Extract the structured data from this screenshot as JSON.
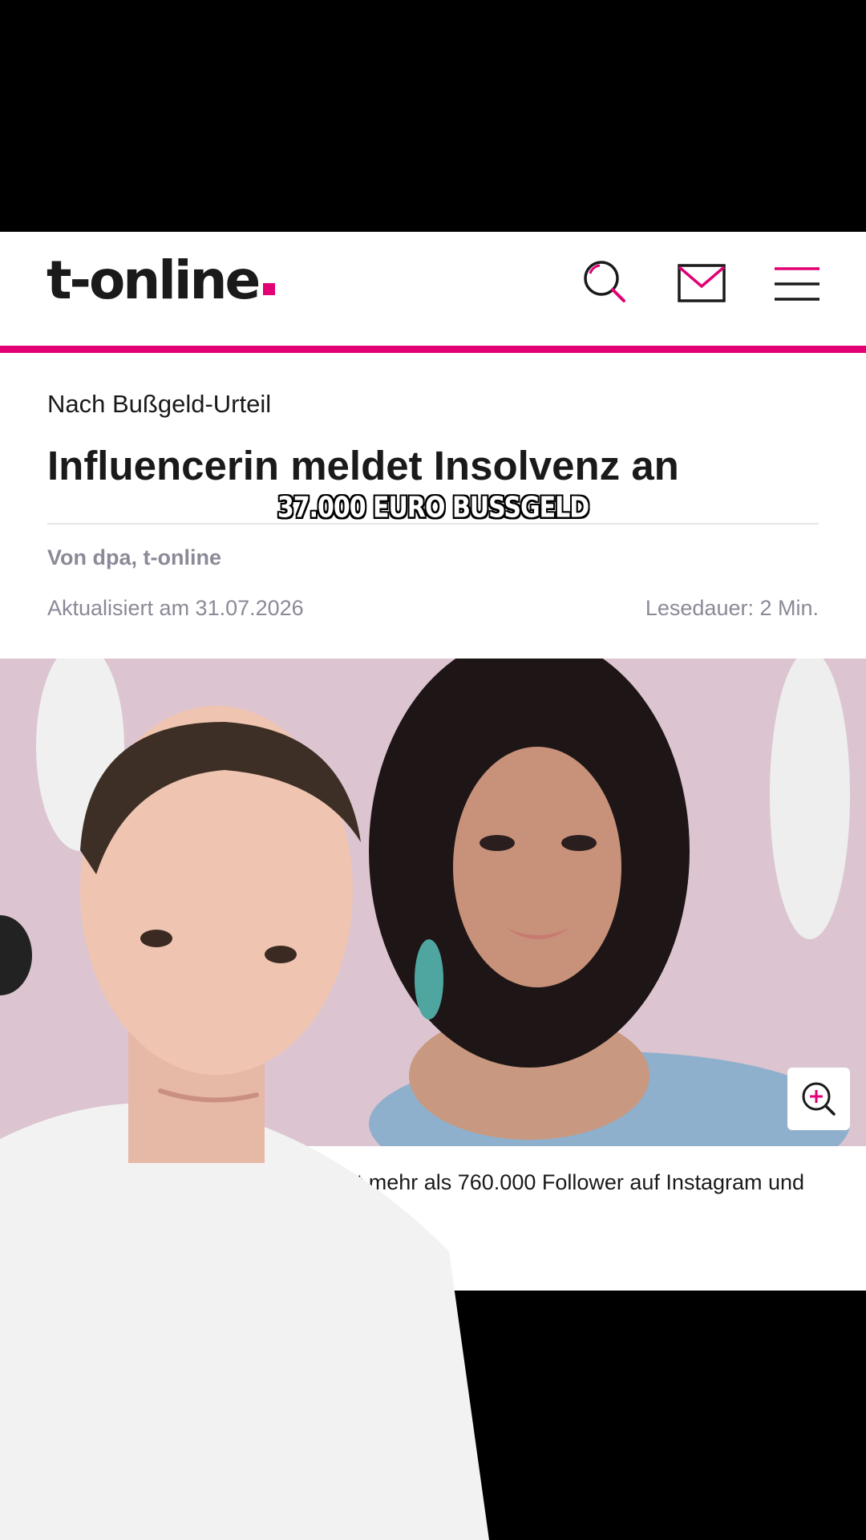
{
  "header": {
    "logo_text": "t-online",
    "accent_color": "#e20074",
    "icons": [
      "search-icon",
      "mail-icon",
      "menu-icon"
    ]
  },
  "article": {
    "kicker": "Nach Bußgeld-Urteil",
    "headline": "Influencerin meldet Insolvenz an",
    "author": "Von dpa, t-online",
    "updated": "Aktualisiert am 31.07.2026",
    "reading_time": "Lesedauer: 2 Min.",
    "image_caption": "Die Influencerin aus Stuttgart hat mehr als 760.000 Follower auf Instagram und TikTok. (Quelle: IMAGO / STAR-"
  },
  "video_overlay": {
    "caption": "37.000 EURO BUSSGELD"
  }
}
